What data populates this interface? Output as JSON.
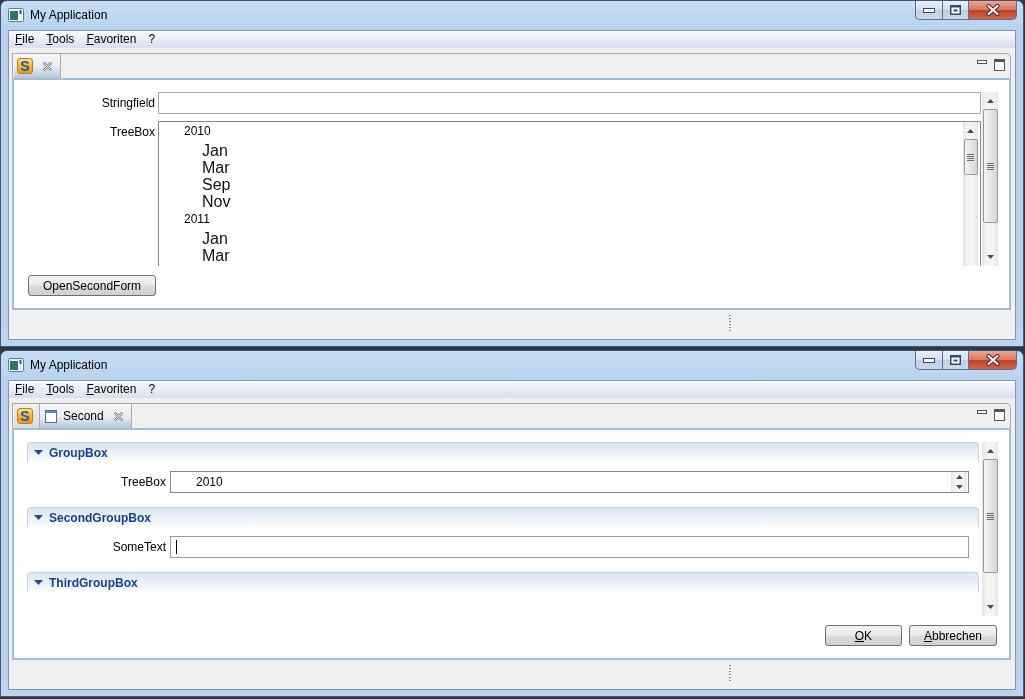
{
  "windows": [
    {
      "title": "My Application",
      "menu": [
        "File",
        "Tools",
        "Favoriten",
        "?"
      ],
      "tabs": [
        {
          "kind": "app",
          "logo": "S",
          "closable": true,
          "selected": true
        }
      ],
      "form": {
        "fields": [
          {
            "kind": "text",
            "label": "Stringfield",
            "focused": false
          },
          {
            "kind": "tree",
            "label": "TreeBox",
            "items": [
              {
                "label": "2010",
                "children": [
                  {
                    "label": "Jan"
                  },
                  {
                    "label": "Mar"
                  },
                  {
                    "label": "Sep"
                  },
                  {
                    "label": "Nov"
                  }
                ]
              },
              {
                "label": "2011",
                "children": [
                  {
                    "label": "Jan"
                  },
                  {
                    "label": "Mar"
                  }
                ]
              }
            ]
          }
        ],
        "buttons": [
          {
            "kind": "process",
            "label": "OpenSecondForm"
          }
        ]
      }
    },
    {
      "title": "My Application",
      "menu": [
        "File",
        "Tools",
        "Favoriten",
        "?"
      ],
      "tabs": [
        {
          "kind": "app",
          "logo": "S",
          "closable": false,
          "selected": false
        },
        {
          "kind": "form",
          "label": "Second",
          "closable": true,
          "selected": true
        }
      ],
      "form": {
        "groups": [
          {
            "title": "GroupBox",
            "expanded": true,
            "fields": [
              {
                "kind": "tree",
                "label": "TreeBox",
                "items": [
                  {
                    "label": "2010"
                  }
                ]
              }
            ]
          },
          {
            "title": "SecondGroupBox",
            "expanded": true,
            "fields": [
              {
                "kind": "text",
                "label": "SomeText",
                "focused": true
              }
            ]
          },
          {
            "title": "ThirdGroupBox",
            "expanded": true
          }
        ],
        "buttons": [
          {
            "kind": "system",
            "label": "OK"
          },
          {
            "kind": "system",
            "label": "Abbrechen"
          }
        ]
      }
    }
  ]
}
